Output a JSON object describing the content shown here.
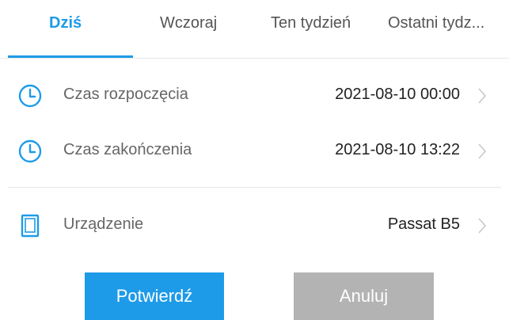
{
  "tabs": [
    {
      "label": "Dziś",
      "active": true
    },
    {
      "label": "Wczoraj",
      "active": false
    },
    {
      "label": "Ten tydzień",
      "active": false
    },
    {
      "label": "Ostatni tydz...",
      "active": false
    }
  ],
  "rows": {
    "start": {
      "label": "Czas rozpoczęcia",
      "value": "2021-08-10 00:00",
      "icon": "clock-icon"
    },
    "end": {
      "label": "Czas zakończenia",
      "value": "2021-08-10 13:22",
      "icon": "clock-icon"
    },
    "device": {
      "label": "Urządzenie",
      "value": "Passat B5",
      "icon": "tablet-icon"
    }
  },
  "buttons": {
    "confirm": "Potwierdź",
    "cancel": "Anuluj"
  },
  "colors": {
    "accent": "#1e9be8",
    "cancel": "#b3b3b3",
    "divider": "#e8e8e8"
  }
}
